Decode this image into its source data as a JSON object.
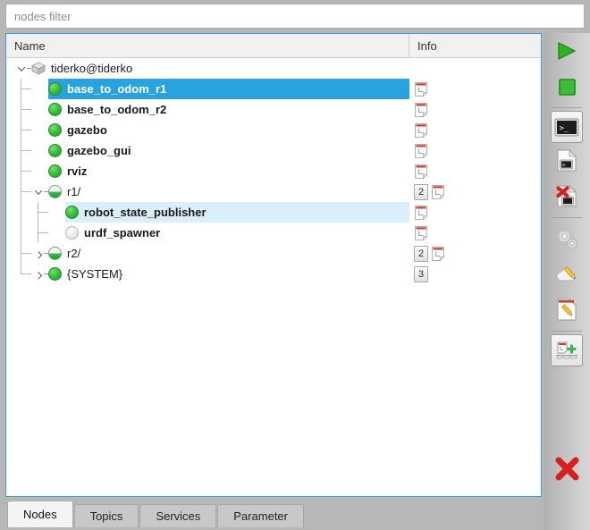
{
  "filter": {
    "placeholder": "nodes filter",
    "value": ""
  },
  "tree": {
    "columns": {
      "name": "Name",
      "info": "Info"
    },
    "rows": [
      {
        "label": "tiderko@tiderko",
        "icon": "host-cube-icon",
        "depth": 0,
        "expander": "down",
        "bold": false,
        "state": "normal",
        "info": []
      },
      {
        "label": "base_to_odom_r1",
        "icon": "status-circle-green",
        "depth": 1,
        "expander": "none",
        "bold": true,
        "state": "selected",
        "info": [
          "note"
        ]
      },
      {
        "label": "base_to_odom_r2",
        "icon": "status-circle-green",
        "depth": 1,
        "expander": "none",
        "bold": true,
        "state": "normal",
        "info": [
          "note"
        ]
      },
      {
        "label": "gazebo",
        "icon": "status-circle-green",
        "depth": 1,
        "expander": "none",
        "bold": true,
        "state": "normal",
        "info": [
          "note"
        ]
      },
      {
        "label": "gazebo_gui",
        "icon": "status-circle-green",
        "depth": 1,
        "expander": "none",
        "bold": true,
        "state": "normal",
        "info": [
          "note"
        ]
      },
      {
        "label": "rviz",
        "icon": "status-circle-green",
        "depth": 1,
        "expander": "none",
        "bold": true,
        "state": "normal",
        "info": [
          "note"
        ]
      },
      {
        "label": "r1/",
        "icon": "status-circle-half",
        "depth": 1,
        "expander": "down",
        "bold": false,
        "state": "normal",
        "info": [
          "2",
          "note"
        ]
      },
      {
        "label": "robot_state_publisher",
        "icon": "status-circle-green",
        "depth": 2,
        "expander": "none",
        "bold": true,
        "state": "hover",
        "info": [
          "note"
        ]
      },
      {
        "label": "urdf_spawner",
        "icon": "status-circle-grey",
        "depth": 2,
        "expander": "none",
        "bold": true,
        "state": "normal",
        "info": [
          "note"
        ]
      },
      {
        "label": "r2/",
        "icon": "status-circle-half",
        "depth": 1,
        "expander": "right",
        "bold": false,
        "state": "normal",
        "info": [
          "2",
          "note"
        ]
      },
      {
        "label": "{SYSTEM}",
        "icon": "status-circle-green",
        "depth": 1,
        "expander": "right",
        "bold": false,
        "state": "normal",
        "info": [
          "3"
        ]
      }
    ]
  },
  "toolbar": {
    "buttons": [
      {
        "name": "start-button",
        "icon": "play-triangle-icon",
        "framed": false
      },
      {
        "name": "stop-button",
        "icon": "stop-square-icon",
        "framed": false
      },
      {
        "name": "separator-1",
        "icon": "separator",
        "framed": false
      },
      {
        "name": "open-terminal-button",
        "icon": "terminal-icon",
        "framed": true
      },
      {
        "name": "show-log-button",
        "icon": "document-terminal-icon",
        "framed": false
      },
      {
        "name": "delete-log-button",
        "icon": "document-terminal-delete-icon",
        "framed": false
      },
      {
        "name": "separator-2",
        "icon": "separator",
        "framed": false
      },
      {
        "name": "dynamic-reconfigure-button",
        "icon": "gears-icon",
        "framed": false
      },
      {
        "name": "edit-cloud-button",
        "icon": "cloud-pencil-icon",
        "framed": false
      },
      {
        "name": "edit-file-button",
        "icon": "document-pencil-icon",
        "framed": false
      },
      {
        "name": "separator-3",
        "icon": "separator",
        "framed": false
      },
      {
        "name": "add-launch-button",
        "icon": "add-document-icon",
        "framed": true
      },
      {
        "name": "close-button",
        "icon": "red-x-icon",
        "framed": false
      }
    ]
  },
  "tabs": {
    "items": [
      {
        "label": "Nodes",
        "active": true
      },
      {
        "label": "Topics",
        "active": false
      },
      {
        "label": "Services",
        "active": false
      },
      {
        "label": "Parameter",
        "active": false
      }
    ]
  },
  "colors": {
    "selection": "#29a3e0",
    "hover_row": "#dbeefb",
    "panel_border": "#3aa3dd",
    "status_ok": "#36c03c",
    "status_off": "#e0e0e0",
    "accent_red": "#d81f1f",
    "window_bg": "#b7b7b7"
  }
}
